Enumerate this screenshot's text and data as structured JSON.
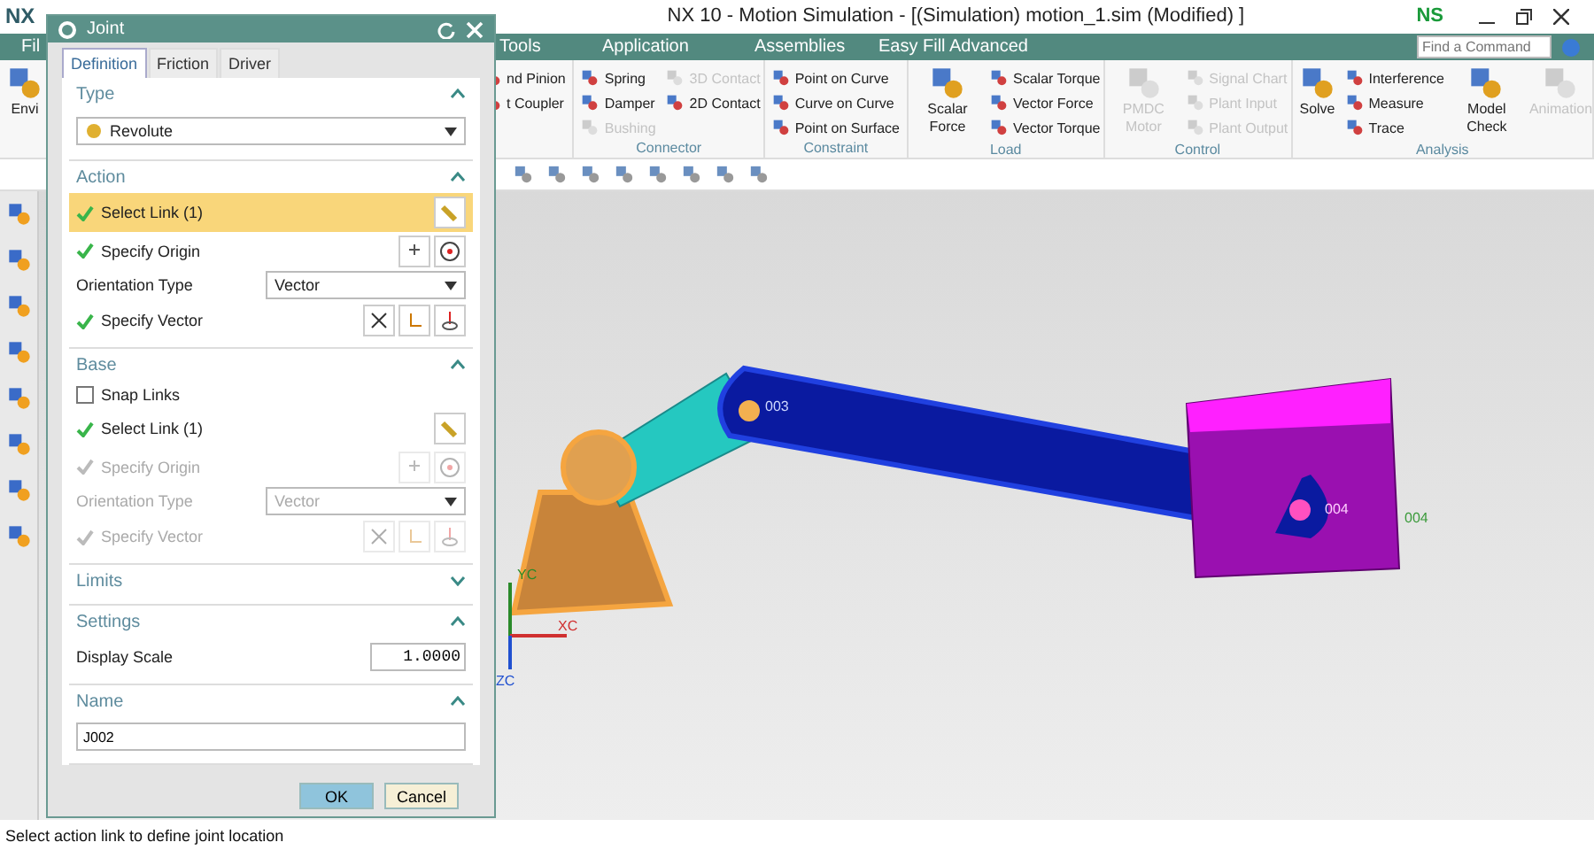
{
  "window": {
    "app": "NX",
    "title": "NX 10 - Motion Simulation - [(Simulation) motion_1.sim (Modified) ]",
    "badge": "NS"
  },
  "menu": {
    "items": [
      "Fil",
      "Tools",
      "Application",
      "Assemblies",
      "Easy Fill Advanced"
    ],
    "search": {
      "placeholder": "Find a Command"
    }
  },
  "ribbon": {
    "groups": [
      {
        "items": [
          {
            "label": "Envi",
            "kind": "large",
            "disabled": false
          }
        ]
      },
      {
        "items": [
          {
            "label": "nd Pinion",
            "kind": "small",
            "disabled": false
          },
          {
            "label": "t Coupler",
            "kind": "small",
            "disabled": false
          }
        ]
      },
      {
        "label": "Connector",
        "items": [
          {
            "label": "Spring",
            "kind": "small",
            "disabled": false
          },
          {
            "label": "Damper",
            "kind": "small",
            "disabled": false
          },
          {
            "label": "Bushing",
            "kind": "small",
            "disabled": true
          },
          {
            "label": "3D Contact",
            "kind": "small",
            "disabled": true
          },
          {
            "label": "2D Contact",
            "kind": "small",
            "disabled": false
          }
        ]
      },
      {
        "label": "Constraint",
        "items": [
          {
            "label": "Point on Curve",
            "kind": "small",
            "disabled": false
          },
          {
            "label": "Curve on Curve",
            "kind": "small",
            "disabled": false
          },
          {
            "label": "Point on Surface",
            "kind": "small",
            "disabled": false
          }
        ]
      },
      {
        "label": "Load",
        "items": [
          {
            "label": "Scalar Force",
            "kind": "large",
            "disabled": false
          },
          {
            "label": "Scalar Torque",
            "kind": "small",
            "disabled": false
          },
          {
            "label": "Vector Force",
            "kind": "small",
            "disabled": false
          },
          {
            "label": "Vector Torque",
            "kind": "small",
            "disabled": false
          }
        ]
      },
      {
        "label": "Control",
        "items": [
          {
            "label": "PMDC Motor",
            "kind": "large",
            "disabled": true
          },
          {
            "label": "Signal Chart",
            "kind": "small",
            "disabled": true
          },
          {
            "label": "Plant Input",
            "kind": "small",
            "disabled": true
          },
          {
            "label": "Plant Output",
            "kind": "small",
            "disabled": true
          }
        ]
      },
      {
        "label": "Analysis",
        "items": [
          {
            "label": "Solve",
            "kind": "large",
            "disabled": false
          },
          {
            "label": "Interference",
            "kind": "small",
            "disabled": false
          },
          {
            "label": "Measure",
            "kind": "small",
            "disabled": false
          },
          {
            "label": "Trace",
            "kind": "small",
            "disabled": false
          },
          {
            "label": "Model Check",
            "kind": "large",
            "disabled": false
          },
          {
            "label": "Animation",
            "kind": "large",
            "disabled": true
          }
        ]
      }
    ]
  },
  "viewport": {
    "labels": [
      "003",
      "004",
      "004"
    ],
    "axes": [
      "YC",
      "XC",
      "ZC"
    ]
  },
  "dialog": {
    "title": "Joint",
    "tabs": [
      {
        "label": "Definition",
        "selected": true
      },
      {
        "label": "Friction",
        "selected": false
      },
      {
        "label": "Driver",
        "selected": false
      }
    ],
    "sections": [
      {
        "title": "Type",
        "expanded": true,
        "rows": [
          {
            "kind": "dropdown",
            "value": "Revolute",
            "disabled": false
          }
        ]
      },
      {
        "title": "Action",
        "expanded": true,
        "rows": [
          {
            "kind": "select",
            "label": "Select Link (1)",
            "done": true,
            "highlighted": true,
            "disabled": false
          },
          {
            "kind": "point",
            "label": "Specify Origin",
            "done": true,
            "disabled": false
          },
          {
            "kind": "option",
            "label": "Orientation Type",
            "value": "Vector",
            "disabled": false
          },
          {
            "kind": "vector",
            "label": "Specify Vector",
            "done": true,
            "disabled": false
          }
        ]
      },
      {
        "title": "Base",
        "expanded": true,
        "rows": [
          {
            "kind": "checkbox",
            "label": "Snap Links",
            "checked": false,
            "disabled": false
          },
          {
            "kind": "select",
            "label": "Select Link (1)",
            "done": true,
            "highlighted": false,
            "disabled": false
          },
          {
            "kind": "point",
            "label": "Specify Origin",
            "done": true,
            "disabled": true
          },
          {
            "kind": "option",
            "label": "Orientation Type",
            "value": "Vector",
            "disabled": true
          },
          {
            "kind": "vector",
            "label": "Specify Vector",
            "done": true,
            "disabled": true
          }
        ]
      },
      {
        "title": "Limits",
        "expanded": false
      },
      {
        "title": "Settings",
        "expanded": true,
        "rows": [
          {
            "kind": "number",
            "label": "Display Scale",
            "value": "1.0000",
            "disabled": false
          }
        ]
      },
      {
        "title": "Name",
        "expanded": true,
        "rows": [
          {
            "kind": "text",
            "value": "J002",
            "disabled": false
          }
        ]
      }
    ],
    "buttons": [
      {
        "label": "OK",
        "default": true
      },
      {
        "label": "Cancel",
        "default": false
      }
    ]
  },
  "status_bar": {
    "text": "Select action link to define joint location"
  }
}
